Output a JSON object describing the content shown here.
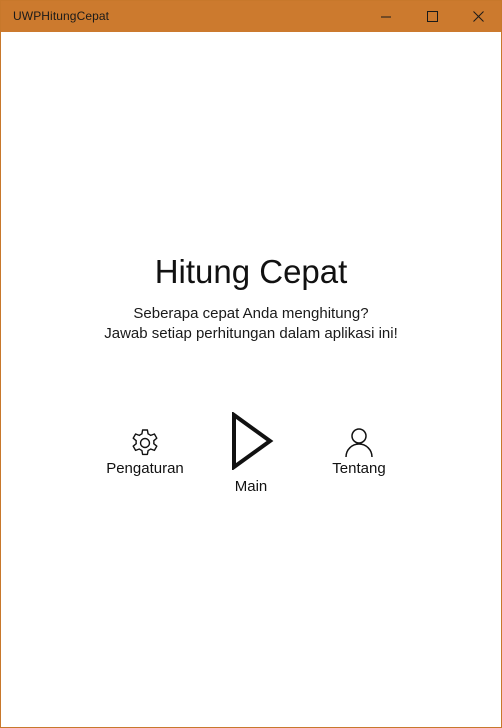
{
  "window": {
    "title": "UWPHitungCepat",
    "accent_color": "#cc7a2e"
  },
  "controls": {
    "minimize_icon": "minimize-icon",
    "maximize_icon": "maximize-icon",
    "close_icon": "close-icon"
  },
  "main": {
    "title": "Hitung Cepat",
    "subtitle_line1": "Seberapa cepat Anda menghitung?",
    "subtitle_line2": "Jawab setiap perhitungan dalam aplikasi ini!"
  },
  "nav": {
    "settings": {
      "label": "Pengaturan",
      "icon": "gear-icon"
    },
    "play": {
      "label": "Main",
      "icon": "play-icon"
    },
    "about": {
      "label": "Tentang",
      "icon": "person-icon"
    }
  }
}
